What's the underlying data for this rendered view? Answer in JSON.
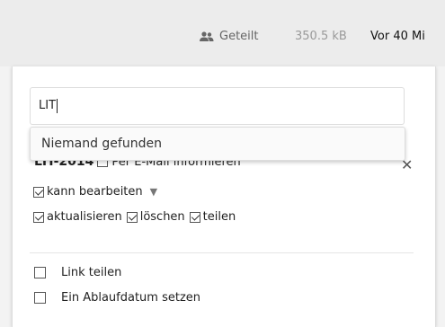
{
  "file_row": {
    "shared_label": "Geteilt",
    "size": "350.5 kB",
    "modified": "Vor 40 Mi"
  },
  "share": {
    "input_value": "LIT",
    "suggestion": "Niemand gefunden",
    "existing_share_name": "LIT-2014",
    "notify_email_label": "Per E-Mail informieren",
    "can_edit_label": "kann bearbeiten",
    "update_label": "aktualisieren",
    "delete_label": "löschen",
    "share_label": "teilen"
  },
  "link": {
    "share_link_label": "Link teilen",
    "expiry_label": "Ein Ablaufdatum setzen"
  }
}
